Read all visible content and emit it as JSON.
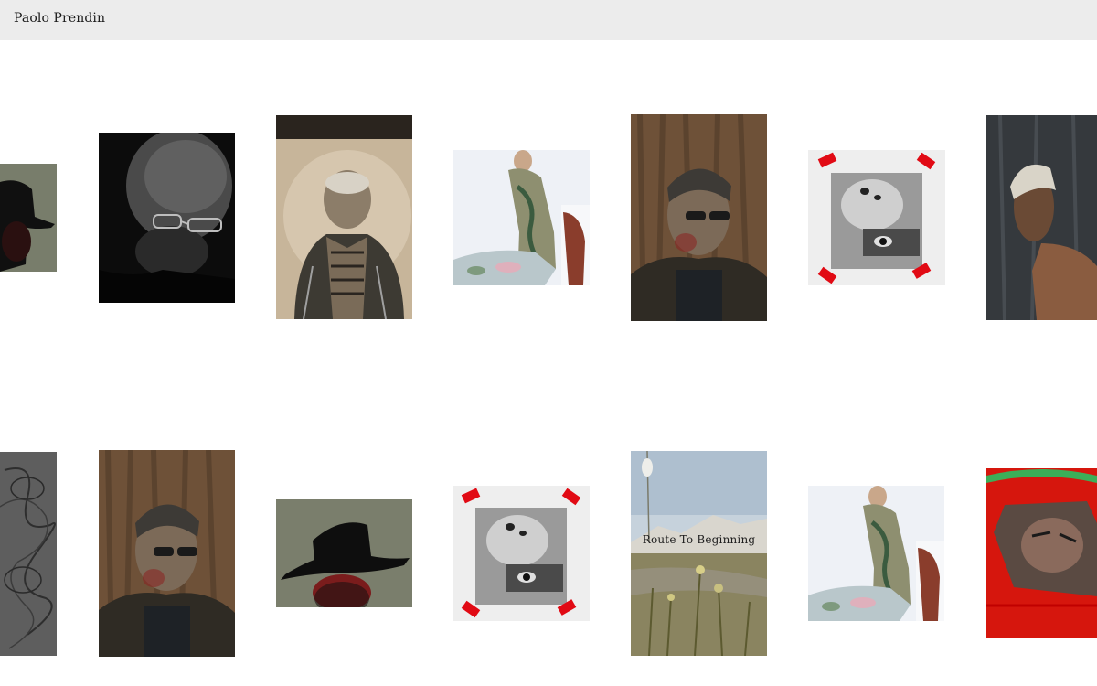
{
  "header": {
    "site_title": "Paolo Prendin"
  },
  "gallery": {
    "featured_caption": "Route To Beginning"
  },
  "colors": {
    "header_bg": "#ececec",
    "page_bg": "#ffffff",
    "tape_red": "#e10a14"
  }
}
